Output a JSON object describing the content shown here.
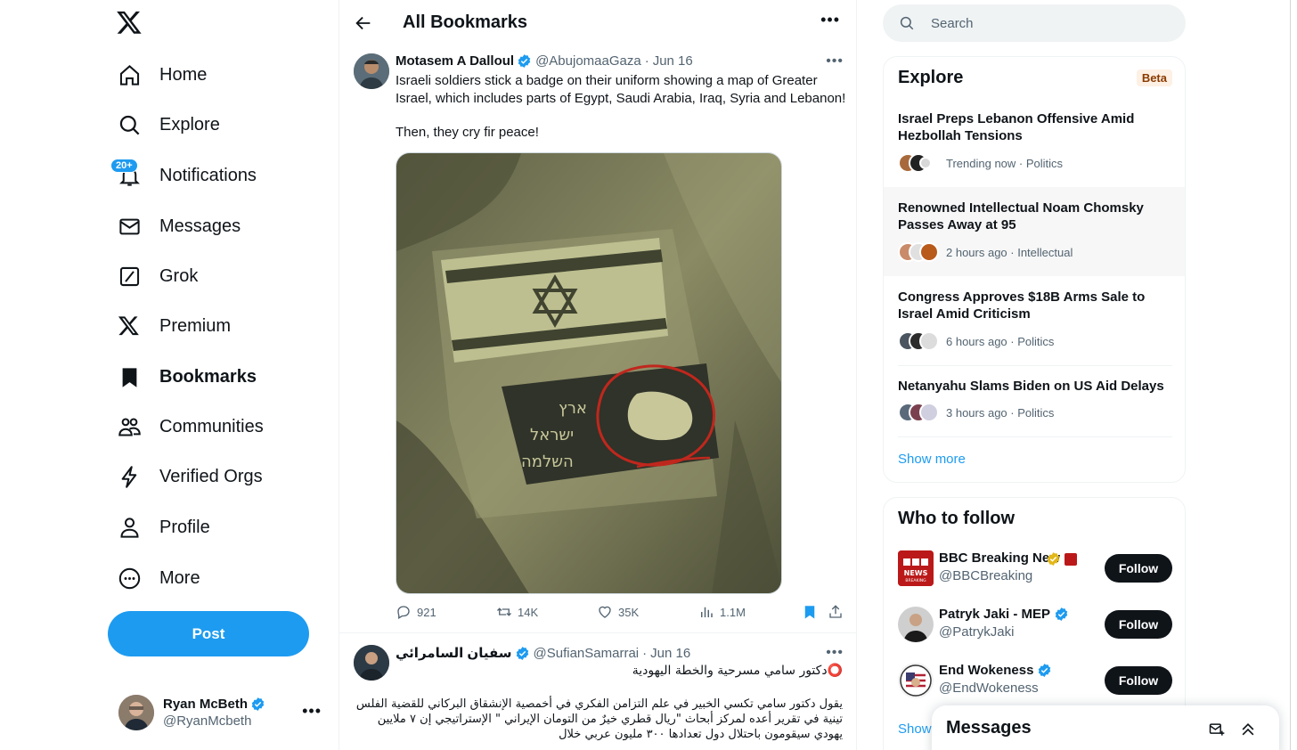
{
  "nav": {
    "items": [
      {
        "label": "Home",
        "icon": "home-icon"
      },
      {
        "label": "Explore",
        "icon": "search-icon"
      },
      {
        "label": "Notifications",
        "icon": "bell-icon",
        "badge": "20+"
      },
      {
        "label": "Messages",
        "icon": "envelope-icon"
      },
      {
        "label": "Grok",
        "icon": "grok-icon"
      },
      {
        "label": "Premium",
        "icon": "x-logo-icon"
      },
      {
        "label": "Bookmarks",
        "icon": "bookmark-icon"
      },
      {
        "label": "Communities",
        "icon": "people-icon"
      },
      {
        "label": "Verified Orgs",
        "icon": "lightning-icon"
      },
      {
        "label": "Profile",
        "icon": "person-icon"
      },
      {
        "label": "More",
        "icon": "more-circle-icon"
      }
    ],
    "post_label": "Post",
    "account": {
      "name": "Ryan McBeth",
      "handle": "@RyanMcbeth"
    }
  },
  "header": {
    "title": "All Bookmarks"
  },
  "tweets": [
    {
      "name": "Motasem A Dalloul",
      "handle": "@AbujomaaGaza",
      "date": "Jun 16",
      "text1": "Israeli soldiers stick a badge on their uniform showing a map of Greater Israel, which includes parts of Egypt, Saudi Arabia, Iraq, Syria and Lebanon!",
      "text2": "Then, they cry fir peace!",
      "replies": "921",
      "reposts": "14K",
      "likes": "35K",
      "views": "1.1M"
    },
    {
      "name": "سفيان السامرائي",
      "handle": "@SufianSamarrai",
      "date": "Jun 16",
      "line1": "⭕️دكتور سامي مسرحية والخطة اليهودية",
      "para": "يقول دكتور سامي تكسي الخبير في علم التزامن الفكري في أخمصية الإنشقاق البركاني للقضية الفلس تينية في تقرير أعده لمركز أبحاث \"ريال قطري خيرٌ من التومان الإيراني \" الإستراتيجي إن ٧ ملايين يهودي سيقومون باحتلال دول تعدادها ٣٠٠ مليون عربي خلال"
    }
  ],
  "search": {
    "placeholder": "Search"
  },
  "explore": {
    "title": "Explore",
    "badge": "Beta",
    "trends": [
      {
        "title": "Israel Preps Lebanon Offensive Amid Hezbollah Tensions",
        "meta": "Trending now · Politics"
      },
      {
        "title": "Renowned Intellectual Noam Chomsky Passes Away at 95",
        "meta": "2 hours ago · Intellectual"
      },
      {
        "title": "Congress Approves $18B Arms Sale to Israel Amid Criticism",
        "meta": "6 hours ago · Politics"
      },
      {
        "title": "Netanyahu Slams Biden on US Aid Delays",
        "meta": "3 hours ago · Politics"
      }
    ],
    "show_more": "Show more"
  },
  "who_to_follow": {
    "title": "Who to follow",
    "accounts": [
      {
        "name": "BBC Breaking News",
        "handle": "@BBCBreaking",
        "button": "Follow",
        "avatar_text": "BBC NEWS BREAKING"
      },
      {
        "name": "Patryk Jaki - MEP",
        "handle": "@PatrykJaki",
        "button": "Follow"
      },
      {
        "name": "End Wokeness",
        "handle": "@EndWokeness",
        "button": "Follow"
      }
    ],
    "show_more": "Show"
  },
  "messages_drawer": {
    "title": "Messages"
  },
  "colors": {
    "accent": "#1d9bf0",
    "text": "#0f1419",
    "muted": "#536471",
    "follow_bg": "#0f1419"
  }
}
